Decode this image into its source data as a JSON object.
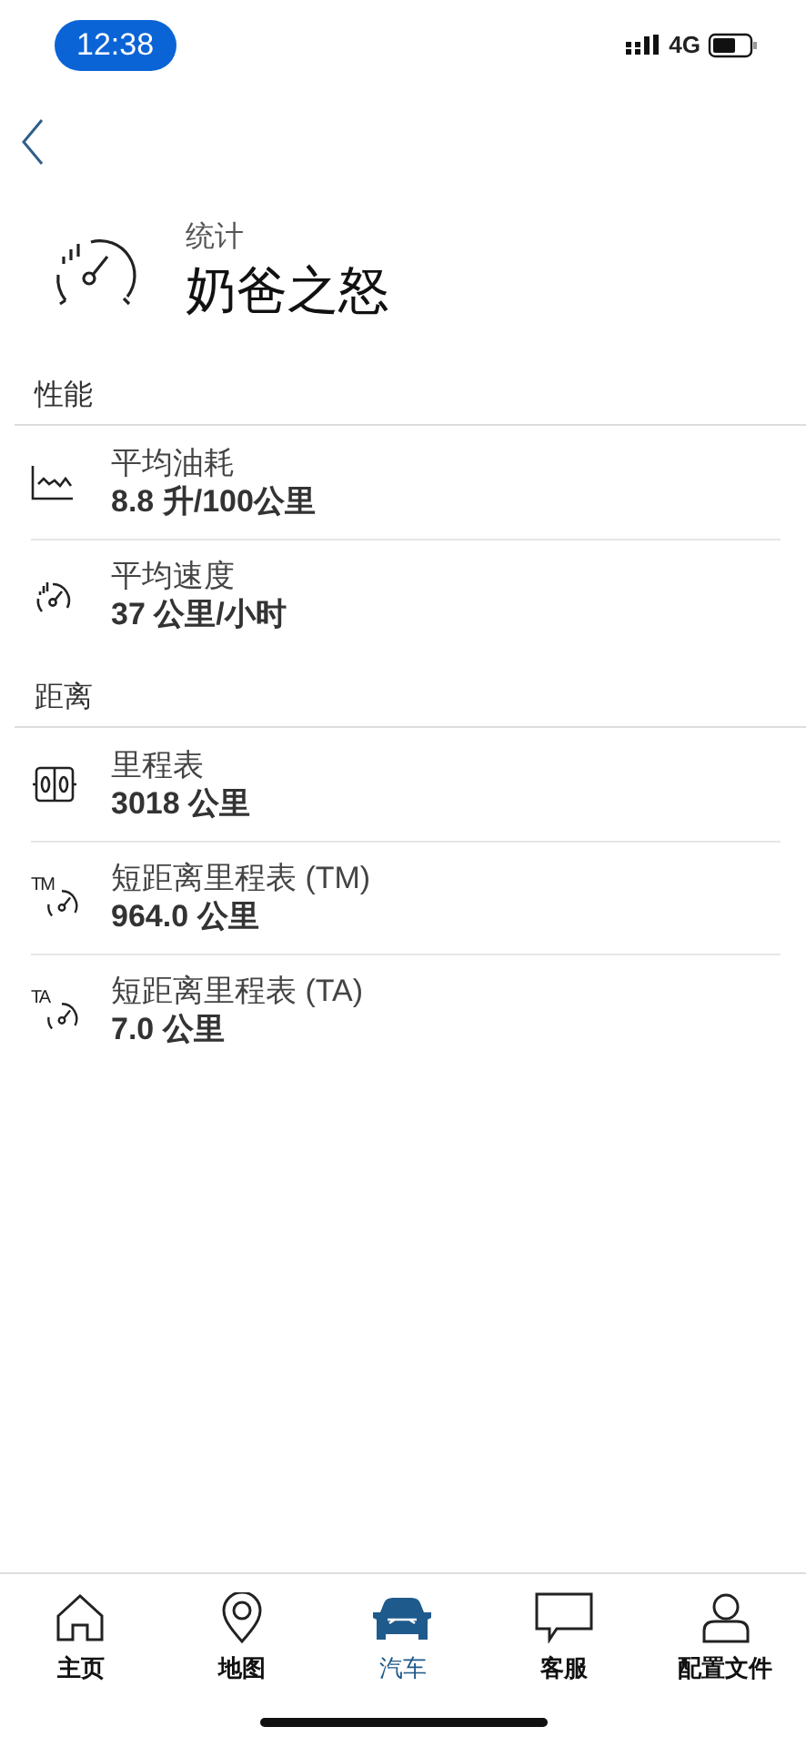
{
  "status_bar": {
    "time": "12:38",
    "network": "4G"
  },
  "header": {
    "subtitle": "统计",
    "title": "奶爸之怒"
  },
  "sections": [
    {
      "title": "性能",
      "items": [
        {
          "kind": "consumption",
          "label": "平均油耗",
          "value": "8.8 升/100公里"
        },
        {
          "kind": "speed",
          "label": "平均速度",
          "value": "37 公里/小时"
        }
      ]
    },
    {
      "title": "距离",
      "items": [
        {
          "kind": "odometer",
          "label": "里程表",
          "value": "3018 公里"
        },
        {
          "kind": "trip",
          "icon_text": "TM",
          "label": "短距离里程表 (TM)",
          "value": "964.0 公里"
        },
        {
          "kind": "trip",
          "icon_text": "TA",
          "label": "短距离里程表 (TA)",
          "value": "7.0 公里"
        }
      ]
    }
  ],
  "tab_bar": [
    {
      "kind": "home",
      "label": "主页",
      "selected": false
    },
    {
      "kind": "map",
      "label": "地图",
      "selected": false
    },
    {
      "kind": "car",
      "label": "汽车",
      "selected": true
    },
    {
      "kind": "chat",
      "label": "客服",
      "selected": false
    },
    {
      "kind": "profile",
      "label": "配置文件",
      "selected": false
    }
  ]
}
